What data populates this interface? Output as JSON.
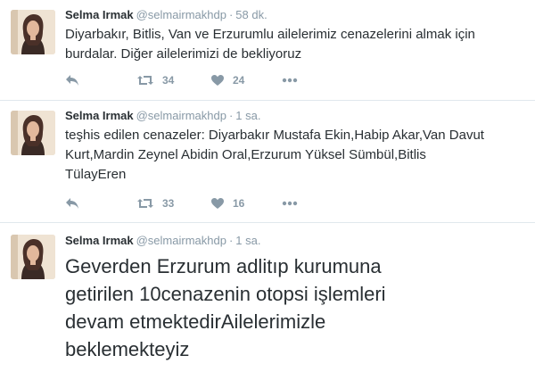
{
  "tweets": [
    {
      "author_name": "Selma Irmak",
      "author_handle": "@selmairmakhdp",
      "time": "58 dk.",
      "text": "Diyarbakır, Bitlis, Van ve Erzurumlu ailelerimiz cenazelerini almak için\nburdalar. Diğer ailelerimizi de bekliyoruz",
      "retweets": "34",
      "likes": "24"
    },
    {
      "author_name": "Selma Irmak",
      "author_handle": "@selmairmakhdp",
      "time": "1 sa.",
      "text": "teşhis edilen cenazeler: Diyarbakır Mustafa Ekin,Habip Akar,Van Davut\nKurt,Mardin Zeynel Abidin Oral,Erzurum Yüksel Sümbül,Bitlis\nTülayEren",
      "retweets": "33",
      "likes": "16"
    },
    {
      "author_name": "Selma Irmak",
      "author_handle": "@selmairmakhdp",
      "time": "1 sa.",
      "text": "Geverden Erzurum adlitıp kurumuna\ngetirilen 10cenazenin otopsi işlemleri\ndevam etmektedirAilelerimizle\nbeklemekteyiz"
    }
  ],
  "icons": {
    "reply": "reply-icon",
    "retweet": "retweet-icon",
    "like": "heart-icon",
    "more": "more-icon"
  },
  "colors": {
    "text": "#292f33",
    "muted": "#8899a6",
    "divider": "#e1e8ed"
  }
}
